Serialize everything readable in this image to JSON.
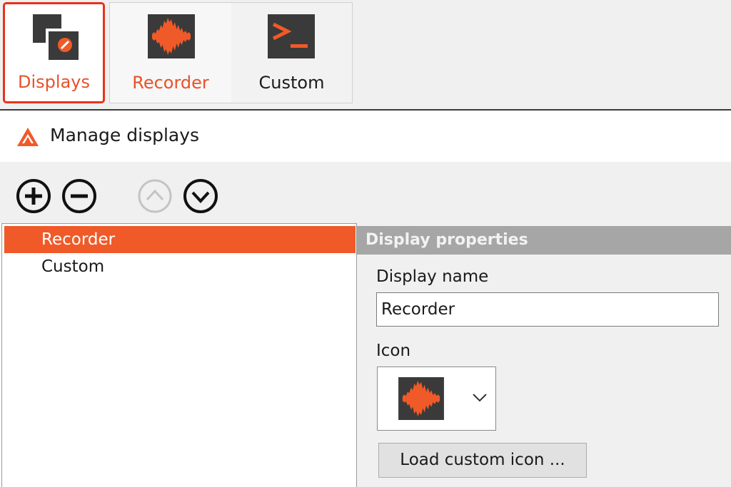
{
  "ribbon": {
    "tabs": [
      {
        "label": "Displays",
        "icon": "displays-icon",
        "state": "selected"
      },
      {
        "label": "Recorder",
        "icon": "recorder-waveform-icon"
      },
      {
        "label": "Custom",
        "icon": "terminal-prompt-icon"
      }
    ]
  },
  "header": {
    "title": "Manage displays",
    "icon": "app-logo-icon"
  },
  "toolbar": {
    "buttons": [
      {
        "icon": "add-circle-icon",
        "enabled": true
      },
      {
        "icon": "remove-circle-icon",
        "enabled": true
      },
      {
        "icon": "move-up-icon",
        "enabled": false
      },
      {
        "icon": "move-down-icon",
        "enabled": true
      }
    ]
  },
  "display_list": {
    "items": [
      {
        "label": "Recorder",
        "selected": true
      },
      {
        "label": "Custom",
        "selected": false
      }
    ]
  },
  "properties": {
    "title": "Display properties",
    "name_label": "Display name",
    "name_value": "Recorder",
    "icon_label": "Icon",
    "icon_value": "recorder-waveform-icon",
    "load_button": "Load custom icon ..."
  },
  "colors": {
    "accent": "#f05a28",
    "selected_tab_border": "#e8321c",
    "icon_dark": "#3a3a3a",
    "panel_header": "#a6a6a6"
  }
}
